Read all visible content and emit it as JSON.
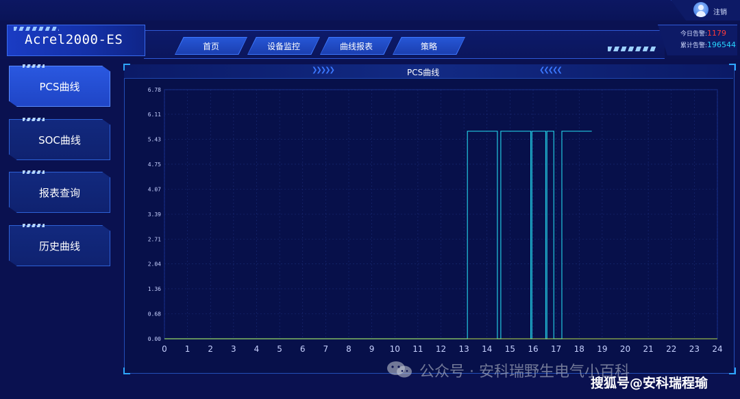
{
  "topbar": {
    "logout_label": "注销"
  },
  "header": {
    "brand_title": "Acrel2000-ES",
    "tabs": [
      {
        "label": "首页"
      },
      {
        "label": "设备监控"
      },
      {
        "label": "曲线报表"
      },
      {
        "label": "策略"
      }
    ],
    "alarms": {
      "today_label": "今日告警:",
      "today_value": "1179",
      "total_label": "累计告警:",
      "total_value": "196544"
    }
  },
  "sidebar": {
    "items": [
      {
        "label": "PCS曲线",
        "active": true
      },
      {
        "label": "SOC曲线",
        "active": false
      },
      {
        "label": "报表查询",
        "active": false
      },
      {
        "label": "历史曲线",
        "active": false
      }
    ]
  },
  "panel": {
    "title": "PCS曲线"
  },
  "colors": {
    "background": "#0a1150",
    "accent": "#2a58e0",
    "series_cyan": "#22c8e0",
    "series_green": "#b8e04a",
    "alarm_today": "#ff3b3b",
    "alarm_total": "#27d6ff"
  },
  "chart_data": {
    "type": "line",
    "title": "PCS曲线",
    "xlabel": "",
    "ylabel": "",
    "xlim": [
      0,
      24
    ],
    "ylim": [
      0,
      6.78
    ],
    "x_ticks": [
      "0",
      "1",
      "2",
      "3",
      "4",
      "5",
      "6",
      "7",
      "8",
      "9",
      "10",
      "11",
      "12",
      "13",
      "14",
      "15",
      "16",
      "17",
      "18",
      "19",
      "20",
      "21",
      "22",
      "23",
      "24"
    ],
    "y_ticks": [
      "0.00",
      "0.68",
      "1.36",
      "2.04",
      "2.71",
      "3.39",
      "4.07",
      "4.75",
      "5.43",
      "6.11",
      "6.78"
    ],
    "grid": true,
    "series": [
      {
        "step": true,
        "x": [
          0,
          13.15,
          13.15,
          14.45,
          14.45,
          14.6,
          14.6,
          15.9,
          15.9,
          15.95,
          15.95,
          16.55,
          16.55,
          16.6,
          16.6,
          16.9,
          16.9,
          17.25,
          17.25,
          18.55
        ],
        "y": [
          0,
          0,
          5.65,
          5.65,
          0,
          0,
          5.65,
          5.65,
          0,
          0,
          5.65,
          5.65,
          0,
          0,
          5.65,
          5.65,
          0,
          0,
          5.65,
          5.65
        ]
      },
      {
        "step": false,
        "x": [
          0,
          24
        ],
        "y": [
          0,
          0
        ]
      }
    ]
  },
  "watermark": {
    "channel_text": "公众号 · 安科瑞野生电气小百科",
    "source_text": "搜狐号@安科瑞程瑜"
  }
}
